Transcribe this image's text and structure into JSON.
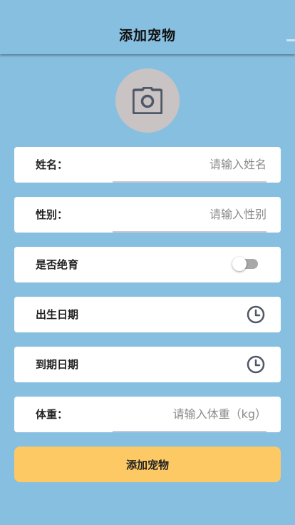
{
  "header": {
    "title": "添加宠物"
  },
  "avatar": {
    "icon": "camera-icon"
  },
  "form": {
    "name": {
      "label": "姓名：",
      "placeholder": "请输入姓名",
      "value": ""
    },
    "gender": {
      "label": "性别：",
      "placeholder": "请输入性别",
      "value": ""
    },
    "neutered": {
      "label": "是否绝育",
      "on": false
    },
    "birth_date": {
      "label": "出生日期",
      "icon": "clock-icon"
    },
    "expire_date": {
      "label": "到期日期",
      "icon": "clock-icon"
    },
    "weight": {
      "label": "体重：",
      "placeholder": "请输入体重（kg）",
      "value": ""
    }
  },
  "submit": {
    "label": "添加宠物"
  },
  "colors": {
    "background": "#87bfe0",
    "button": "#fdc964",
    "card": "#ffffff",
    "avatar": "#c9c4c3"
  }
}
